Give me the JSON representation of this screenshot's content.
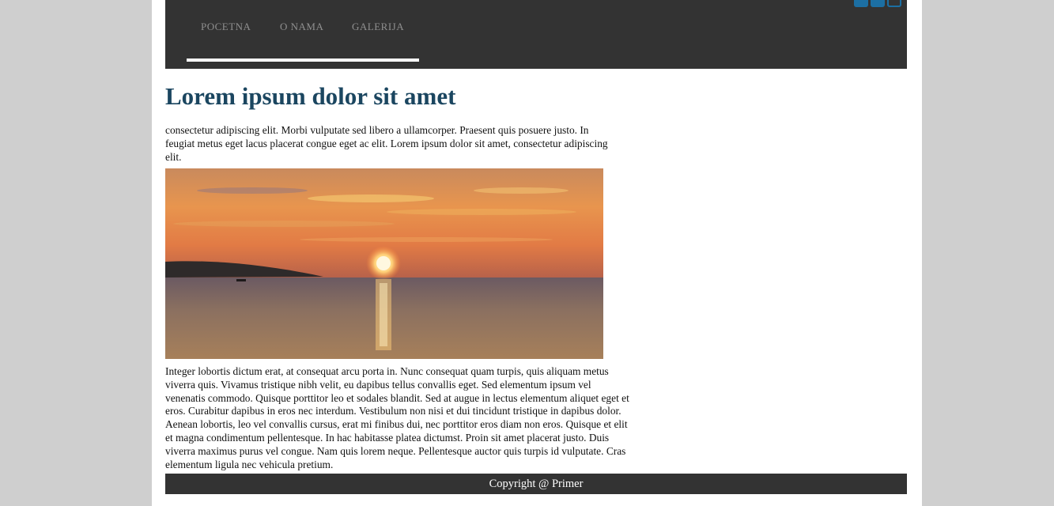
{
  "nav": {
    "items": [
      "POCETNA",
      "O NAMA",
      "GALERIJA"
    ],
    "social_icons": [
      "facebook-icon",
      "twitter-icon",
      "email-icon"
    ]
  },
  "main": {
    "title": "Lorem ipsum dolor sit amet",
    "intro": "consectetur adipiscing elit. Morbi vulputate sed libero a ullamcorper. Praesent quis posuere justo. In feugiat metus eget lacus placerat congue eget ac elit. Lorem ipsum dolor sit amet, consectetur adipiscing elit.",
    "image_subject": "sunset over sea with boat",
    "body": "Integer lobortis dictum erat, at consequat arcu porta in. Nunc consequat quam turpis, quis aliquam metus viverra quis. Vivamus tristique nibh velit, eu dapibus tellus convallis eget. Sed elementum ipsum vel venenatis commodo. Quisque porttitor leo et sodales blandit. Sed at augue in lectus elementum aliquet eget et eros. Curabitur dapibus in eros nec interdum. Vestibulum non nisi et dui tincidunt tristique in dapibus dolor. Aenean lobortis, leo vel convallis cursus, erat mi finibus dui, nec porttitor eros diam non eros. Quisque et elit et magna condimentum pellentesque. In hac habitasse platea dictumst. Proin sit amet placerat justo. Duis viverra maximus purus vel congue. Nam quis lorem neque. Pellentesque auctor quis turpis id vulputate. Cras elementum ligula nec vehicula pretium."
  },
  "footer": {
    "text": "Copyright @ Primer"
  },
  "colors": {
    "page_bg": "#cfcfcf",
    "nav_bg": "#333333",
    "title": "#1b4660",
    "social": "#1c6fa3"
  }
}
